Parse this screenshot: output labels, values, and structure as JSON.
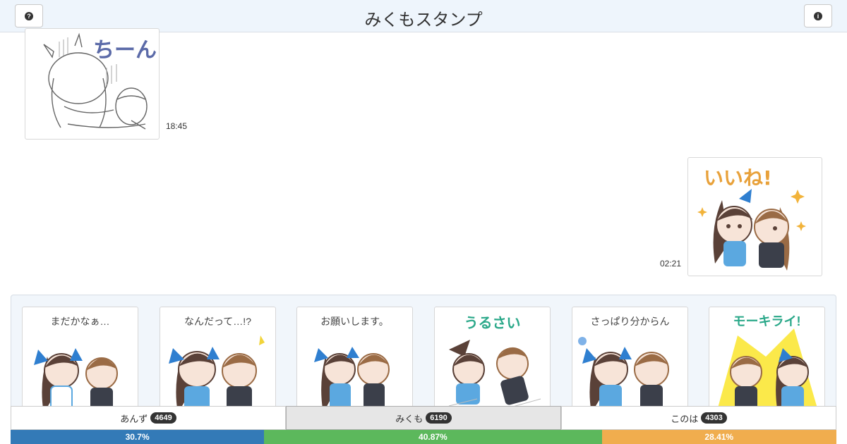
{
  "header": {
    "title": "みくもスタンプ",
    "help_icon": "question-circle-icon",
    "info_icon": "info-circle-icon"
  },
  "messages": [
    {
      "sticker_text": "ちーん",
      "time": "18:45"
    },
    {
      "sticker_text": "いいね!",
      "time": "02:21"
    }
  ],
  "tray": {
    "stickers": [
      {
        "caption": "まだかなぁ…"
      },
      {
        "caption": "なんだって…!?"
      },
      {
        "caption": "お願いします。"
      },
      {
        "caption": "うるさい"
      },
      {
        "caption": "さっぱり分からん"
      },
      {
        "caption": "モーキライ!"
      }
    ]
  },
  "votes": [
    {
      "name": "あんず",
      "count": "4649",
      "percent_text": "30.7%",
      "percent": 30.7,
      "color": "#337ab7",
      "active": false
    },
    {
      "name": "みくも",
      "count": "6190",
      "percent_text": "40.87%",
      "percent": 40.87,
      "color": "#5cb85c",
      "active": true
    },
    {
      "name": "このは",
      "count": "4303",
      "percent_text": "28.41%",
      "percent": 28.41,
      "color": "#f0ad4e",
      "active": false
    }
  ]
}
